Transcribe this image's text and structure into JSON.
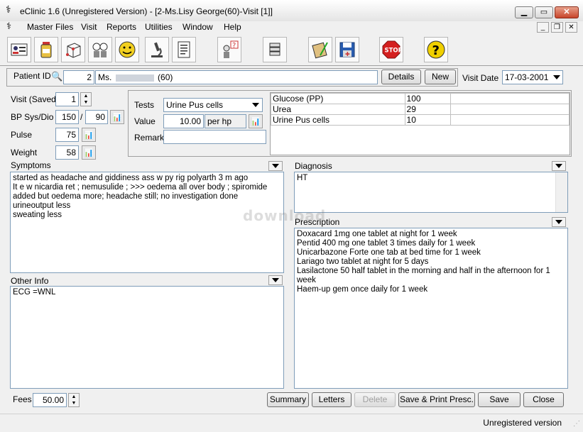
{
  "window": {
    "title": "eClinic 1.6 (Unregistered Version) - [2-Ms.Lisy George(60)-Visit [1]]"
  },
  "menu": {
    "items": [
      "Master Files",
      "Visit",
      "Reports",
      "Utilities",
      "Window",
      "Help"
    ]
  },
  "patient": {
    "id_label": "Patient ID",
    "id_value": "2",
    "name_value": "Ms.",
    "age_value": "(60)",
    "details_label": "Details",
    "new_label": "New",
    "visit_date_label": "Visit Date",
    "visit_date_value": "17-03-2001"
  },
  "vitals": {
    "visit_label": "Visit (Saved)",
    "visit_value": "1",
    "bp_label": "BP Sys/Dio",
    "bp_sys": "150",
    "bp_sep": "/",
    "bp_dio": "90",
    "pulse_label": "Pulse",
    "pulse_value": "75",
    "weight_label": "Weight",
    "weight_value": "58"
  },
  "tests": {
    "tests_label": "Tests",
    "selected_test": "Urine Pus cells",
    "value_label": "Value",
    "value": "10.00",
    "unit": "per hp",
    "remark_label": "Remark",
    "remark_value": "",
    "results": [
      {
        "name": "Glucose (PP)",
        "value": "100",
        "note": ""
      },
      {
        "name": "Urea",
        "value": "29",
        "note": ""
      },
      {
        "name": "Urine Pus cells",
        "value": "10",
        "note": ""
      }
    ]
  },
  "symptoms": {
    "label": "Symptoms",
    "lines": [
      "started as headache and giddiness  ass w py rig polyarth 3 m ago",
      "It e w nicardia ret ; nemusulide ; >>>  oedema all over body ; spiromide",
      "added but oedema  more; headache still; no investigation done",
      "urineoutput  less",
      "sweating less"
    ]
  },
  "other_info": {
    "label": "Other Info",
    "lines": [
      "ECG =WNL"
    ]
  },
  "diagnosis": {
    "label": "Diagnosis",
    "lines": [
      "HT"
    ]
  },
  "prescription": {
    "label": "Prescription",
    "lines": [
      "Doxacard 1mg one tablet at night   for 1 week",
      "Pentid 400 mg one tablet 3 times daily  for 1 week",
      "Unicarbazone Forte one tab at bed time  for 1 week",
      "Lariago two tablet at night   for 5 days",
      "Lasilactone 50  half tablet in the morning and half in the afternoon   for 1",
      "week",
      "Haem-up gem  once daily  for 1 week"
    ]
  },
  "footer": {
    "fees_label": "Fees",
    "fees_value": "50.00",
    "summary_label": "Summary",
    "letters_label": "Letters",
    "delete_label": "Delete",
    "save_print_label": "Save & Print Presc.",
    "save_label": "Save",
    "close_label": "Close"
  },
  "status": {
    "text": "Unregistered version"
  },
  "watermark": "download"
}
